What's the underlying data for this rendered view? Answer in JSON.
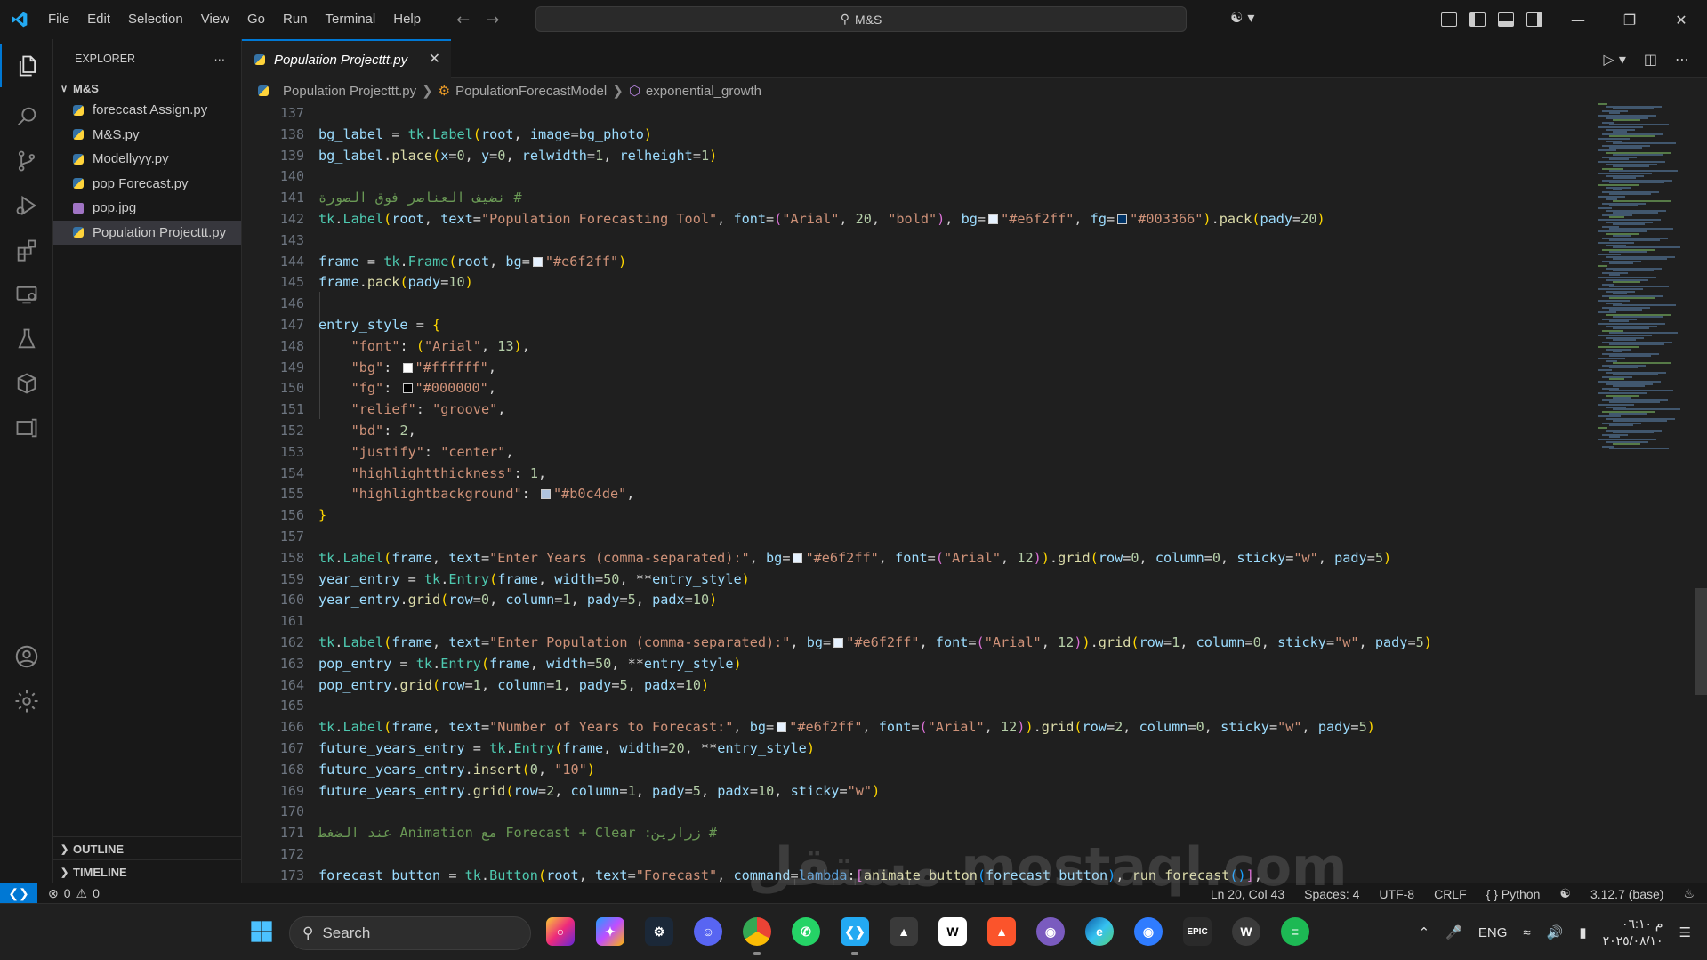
{
  "titlebar": {
    "menu": [
      "File",
      "Edit",
      "Selection",
      "View",
      "Go",
      "Run",
      "Terminal",
      "Help"
    ],
    "search": "M&S"
  },
  "sidebar": {
    "title": "EXPLORER",
    "folder": "M&S",
    "files": [
      {
        "name": "foreccast Assign.py",
        "type": "py"
      },
      {
        "name": "M&S.py",
        "type": "py"
      },
      {
        "name": "Modellyyy.py",
        "type": "py"
      },
      {
        "name": "pop Forecast.py",
        "type": "py"
      },
      {
        "name": "pop.jpg",
        "type": "img"
      },
      {
        "name": "Population Projecttt.py",
        "type": "py",
        "selected": true
      }
    ],
    "outline": "OUTLINE",
    "timeline": "TIMELINE"
  },
  "tab": {
    "label": "Population Projecttt.py"
  },
  "breadcrumb": {
    "file": "Population Projecttt.py",
    "class": "PopulationForecastModel",
    "method": "exponential_growth"
  },
  "editor": {
    "lines": [
      {
        "n": "137",
        "t": ""
      },
      {
        "n": "138",
        "t": "bg_label = tk.Label(root, image=bg_photo)"
      },
      {
        "n": "139",
        "t": "bg_label.place(x=0, y=0, relwidth=1, relheight=1)"
      },
      {
        "n": "140",
        "t": ""
      },
      {
        "n": "141",
        "t": "# نضيف العناصر فوق الصورة"
      },
      {
        "n": "142",
        "t": "tk.Label(root, text=\"Population Forecasting Tool\", font=(\"Arial\", 20, \"bold\"), bg=■\"#e6f2ff\", fg=■\"#003366\").pack(pady=20)"
      },
      {
        "n": "143",
        "t": ""
      },
      {
        "n": "144",
        "t": "frame = tk.Frame(root, bg=■\"#e6f2ff\")"
      },
      {
        "n": "145",
        "t": "frame.pack(pady=10)"
      },
      {
        "n": "146",
        "t": ""
      },
      {
        "n": "147",
        "t": "entry_style = {"
      },
      {
        "n": "148",
        "t": "    \"font\": (\"Arial\", 13),"
      },
      {
        "n": "149",
        "t": "    \"bg\": ■\"#ffffff\","
      },
      {
        "n": "150",
        "t": "    \"fg\": ■\"#000000\","
      },
      {
        "n": "151",
        "t": "    \"relief\": \"groove\","
      },
      {
        "n": "152",
        "t": "    \"bd\": 2,"
      },
      {
        "n": "153",
        "t": "    \"justify\": \"center\","
      },
      {
        "n": "154",
        "t": "    \"highlightthickness\": 1,"
      },
      {
        "n": "155",
        "t": "    \"highlightbackground\": ■\"#b0c4de\","
      },
      {
        "n": "156",
        "t": "}"
      },
      {
        "n": "157",
        "t": ""
      },
      {
        "n": "158",
        "t": "tk.Label(frame, text=\"Enter Years (comma-separated):\", bg=■\"#e6f2ff\", font=(\"Arial\", 12)).grid(row=0, column=0, sticky=\"w\", pady=5)"
      },
      {
        "n": "159",
        "t": "year_entry = tk.Entry(frame, width=50, **entry_style)"
      },
      {
        "n": "160",
        "t": "year_entry.grid(row=0, column=1, pady=5, padx=10)"
      },
      {
        "n": "161",
        "t": ""
      },
      {
        "n": "162",
        "t": "tk.Label(frame, text=\"Enter Population (comma-separated):\", bg=■\"#e6f2ff\", font=(\"Arial\", 12)).grid(row=1, column=0, sticky=\"w\", pady=5)"
      },
      {
        "n": "163",
        "t": "pop_entry = tk.Entry(frame, width=50, **entry_style)"
      },
      {
        "n": "164",
        "t": "pop_entry.grid(row=1, column=1, pady=5, padx=10)"
      },
      {
        "n": "165",
        "t": ""
      },
      {
        "n": "166",
        "t": "tk.Label(frame, text=\"Number of Years to Forecast:\", bg=■\"#e6f2ff\", font=(\"Arial\", 12)).grid(row=2, column=0, sticky=\"w\", pady=5)"
      },
      {
        "n": "167",
        "t": "future_years_entry = tk.Entry(frame, width=20, **entry_style)"
      },
      {
        "n": "168",
        "t": "future_years_entry.insert(0, \"10\")"
      },
      {
        "n": "169",
        "t": "future_years_entry.grid(row=2, column=1, pady=5, padx=10, sticky=\"w\")"
      },
      {
        "n": "170",
        "t": ""
      },
      {
        "n": "171",
        "t": "# زرارين: Forecast + Clear مع Animation عند الضغط"
      },
      {
        "n": "172",
        "t": ""
      },
      {
        "n": "173",
        "t": "forecast_button = tk.Button(root, text=\"Forecast\", command=lambda:[animate_button(forecast_button), run_forecast()],"
      }
    ]
  },
  "statusbar": {
    "errors": "0",
    "warnings": "0",
    "position": "Ln 20, Col 43",
    "spaces": "Spaces: 4",
    "encoding": "UTF-8",
    "eol": "CRLF",
    "language": "Python",
    "interpreter": "3.12.7 (base)"
  },
  "taskbar": {
    "search": "Search",
    "lang": "ENG",
    "time": "م ٠٦:١٠",
    "date": "٢٠٢٥/٠٨/١٠"
  },
  "watermark": "مستقل mostaql.com",
  "colors": {
    "accent": "#0078d4",
    "bg": "#1f1f1f",
    "sidebar": "#181818"
  }
}
